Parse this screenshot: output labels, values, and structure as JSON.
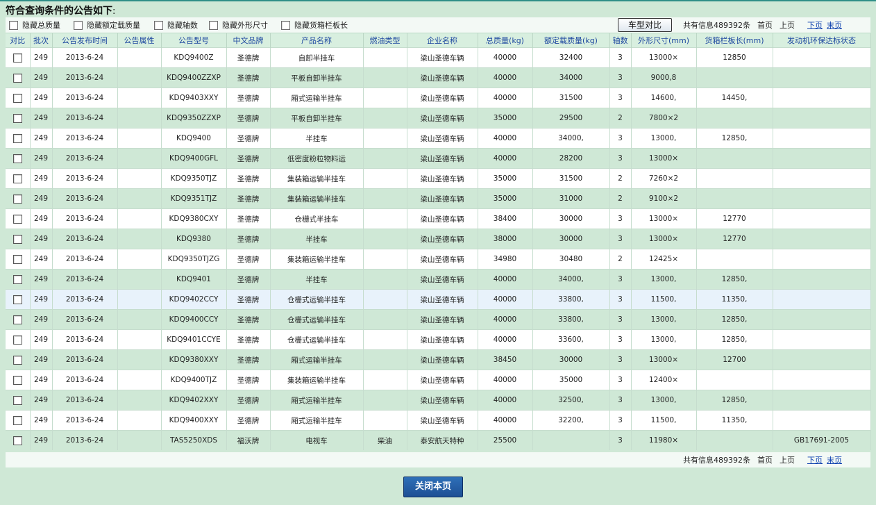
{
  "header": {
    "title": "符合查询条件的公告如下",
    "title_suffix": ":"
  },
  "filters": [
    {
      "label": "隐藏总质量"
    },
    {
      "label": "隐藏额定载质量"
    },
    {
      "label": "隐藏轴数"
    },
    {
      "label": "隐藏外形尺寸"
    },
    {
      "label": "隐藏货箱栏板长"
    }
  ],
  "compare_button": "车型对比",
  "pager": {
    "total": "共有信息489392条",
    "first": "首页",
    "prev": "上页",
    "next": "下页",
    "last": "末页"
  },
  "table": {
    "columns": [
      "对比",
      "批次",
      "公告发布时间",
      "公告属性",
      "公告型号",
      "中文品牌",
      "产品名称",
      "燃油类型",
      "企业名称",
      "总质量(kg)",
      "额定载质量(kg)",
      "轴数",
      "外形尺寸(mm)",
      "货箱栏板长(mm)",
      "发动机环保达标状态"
    ],
    "rows": [
      [
        "",
        "249",
        "2013-6-24",
        "",
        "KDQ9400Z",
        "圣德牌",
        "自卸半挂车",
        "",
        "梁山圣德车辆",
        "40000",
        "32400",
        "3",
        "13000×",
        "12850",
        ""
      ],
      [
        "",
        "249",
        "2013-6-24",
        "",
        "KDQ9400ZZXP",
        "圣德牌",
        "平板自卸半挂车",
        "",
        "梁山圣德车辆",
        "40000",
        "34000",
        "3",
        "9000,8",
        "",
        " "
      ],
      [
        "",
        "249",
        "2013-6-24",
        "",
        "KDQ9403XXY",
        "圣德牌",
        "厢式运输半挂车",
        "",
        "梁山圣德车辆",
        "40000",
        "31500",
        "3",
        "14600,",
        "14450,",
        ""
      ],
      [
        "",
        "249",
        "2013-6-24",
        "",
        "KDQ9350ZZXP",
        "圣德牌",
        "平板自卸半挂车",
        "",
        "梁山圣德车辆",
        "35000",
        "29500",
        "2",
        "7800×2",
        "",
        ""
      ],
      [
        "",
        "249",
        "2013-6-24",
        "",
        "KDQ9400",
        "圣德牌",
        "半挂车",
        "",
        "梁山圣德车辆",
        "40000",
        "34000,",
        "3",
        "13000,",
        "12850,",
        ""
      ],
      [
        "",
        "249",
        "2013-6-24",
        "",
        "KDQ9400GFL",
        "圣德牌",
        "低密度粉粒物料运",
        "",
        "梁山圣德车辆",
        "40000",
        "28200",
        "3",
        "13000×",
        "",
        ""
      ],
      [
        "",
        "249",
        "2013-6-24",
        "",
        "KDQ9350TJZ",
        "圣德牌",
        "集装箱运输半挂车",
        "",
        "梁山圣德车辆",
        "35000",
        "31500",
        "2",
        "7260×2",
        "",
        ""
      ],
      [
        "",
        "249",
        "2013-6-24",
        "",
        "KDQ9351TJZ",
        "圣德牌",
        "集装箱运输半挂车",
        "",
        "梁山圣德车辆",
        "35000",
        "31000",
        "2",
        "9100×2",
        "",
        ""
      ],
      [
        "",
        "249",
        "2013-6-24",
        "",
        "KDQ9380CXY",
        "圣德牌",
        "仓栅式半挂车",
        "",
        "梁山圣德车辆",
        "38400",
        "30000",
        "3",
        "13000×",
        "12770",
        ""
      ],
      [
        "",
        "249",
        "2013-6-24",
        "",
        "KDQ9380",
        "圣德牌",
        "半挂车",
        "",
        "梁山圣德车辆",
        "38000",
        "30000",
        "3",
        "13000×",
        "12770",
        ""
      ],
      [
        "",
        "249",
        "2013-6-24",
        "",
        "KDQ9350TJZG",
        "圣德牌",
        "集装箱运输半挂车",
        "",
        "梁山圣德车辆",
        "34980",
        "30480",
        "2",
        "12425×",
        "",
        ""
      ],
      [
        "",
        "249",
        "2013-6-24",
        "",
        "KDQ9401",
        "圣德牌",
        "半挂车",
        "",
        "梁山圣德车辆",
        "40000",
        "34000,",
        "3",
        "13000,",
        "12850,",
        ""
      ],
      [
        "",
        "249",
        "2013-6-24",
        "",
        "KDQ9402CCY",
        "圣德牌",
        "仓栅式运输半挂车",
        "",
        "梁山圣德车辆",
        "40000",
        "33800,",
        "3",
        "11500,",
        "11350,",
        ""
      ],
      [
        "",
        "249",
        "2013-6-24",
        "",
        "KDQ9400CCY",
        "圣德牌",
        "仓栅式运输半挂车",
        "",
        "梁山圣德车辆",
        "40000",
        "33800,",
        "3",
        "13000,",
        "12850,",
        ""
      ],
      [
        "",
        "249",
        "2013-6-24",
        "",
        "KDQ9401CCYE",
        "圣德牌",
        "仓栅式运输半挂车",
        "",
        "梁山圣德车辆",
        "40000",
        "33600,",
        "3",
        "13000,",
        "12850,",
        ""
      ],
      [
        "",
        "249",
        "2013-6-24",
        "",
        "KDQ9380XXY",
        "圣德牌",
        "厢式运输半挂车",
        "",
        "梁山圣德车辆",
        "38450",
        "30000",
        "3",
        "13000×",
        "12700",
        ""
      ],
      [
        "",
        "249",
        "2013-6-24",
        "",
        "KDQ9400TJZ",
        "圣德牌",
        "集装箱运输半挂车",
        "",
        "梁山圣德车辆",
        "40000",
        "35000",
        "3",
        "12400×",
        "",
        ""
      ],
      [
        "",
        "249",
        "2013-6-24",
        "",
        "KDQ9402XXY",
        "圣德牌",
        "厢式运输半挂车",
        "",
        "梁山圣德车辆",
        "40000",
        "32500,",
        "3",
        "13000,",
        "12850,",
        ""
      ],
      [
        "",
        "249",
        "2013-6-24",
        "",
        "KDQ9400XXY",
        "圣德牌",
        "厢式运输半挂车",
        "",
        "梁山圣德车辆",
        "40000",
        "32200,",
        "3",
        "11500,",
        "11350,",
        ""
      ],
      [
        "",
        "249",
        "2013-6-24",
        "",
        "TAS5250XDS",
        "福沃牌",
        "电视车",
        "柴油",
        "泰安航天特种",
        "25500",
        "",
        "3",
        "11980×",
        "",
        "GB17691-2005"
      ]
    ]
  },
  "close_button": "关闭本页"
}
